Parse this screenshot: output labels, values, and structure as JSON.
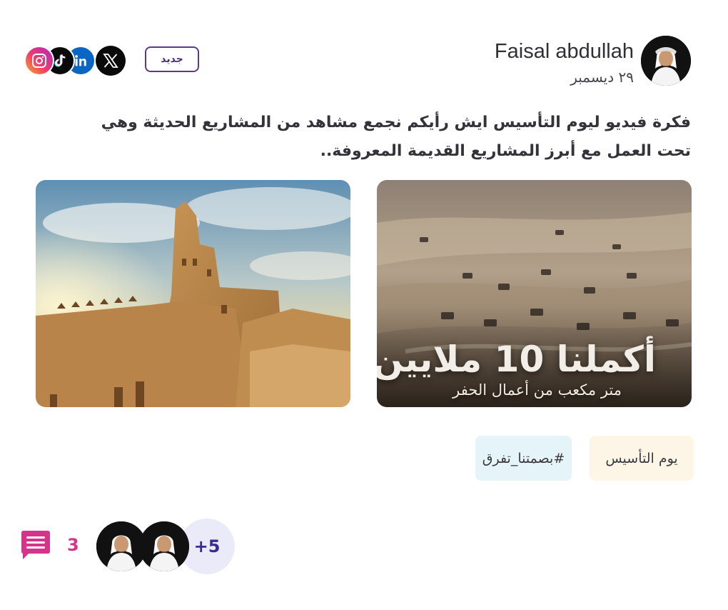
{
  "author": {
    "name": "Faisal abdullah",
    "date": "٢٩ ديسمبر"
  },
  "badge": {
    "label": "جديد"
  },
  "social": [
    {
      "name": "instagram",
      "icon": "instagram-icon",
      "color": "#e1306c"
    },
    {
      "name": "tiktok",
      "icon": "tiktok-icon",
      "color": "#000000"
    },
    {
      "name": "linkedin",
      "icon": "linkedin-icon",
      "color": "#0a66c2"
    },
    {
      "name": "x",
      "icon": "x-icon",
      "color": "#000000"
    }
  ],
  "post": {
    "text": "فكرة فيديو ليوم التأسيس ايش رأيكم نجمع مشاهد من المشاريع الحديثة وهي تحت العمل مع أبرز المشاريع القديمة المعروفة..",
    "images": [
      {
        "name": "excavation-site-image",
        "overlay_title": "أكملنا 10 ملايين",
        "overlay_subtitle": "متر مكعب من أعمال الحفر"
      },
      {
        "name": "historic-mud-fort-image"
      }
    ]
  },
  "tags": [
    "يوم التأسيس",
    "#بصمتنا_تفرق"
  ],
  "footer": {
    "comment_count": "3",
    "more_participants": "+5"
  },
  "colors": {
    "accent": "#4a2e80",
    "comment": "#d6338c",
    "tag_warm": "#fdf6e7",
    "tag_cool": "#e5f4f8"
  }
}
